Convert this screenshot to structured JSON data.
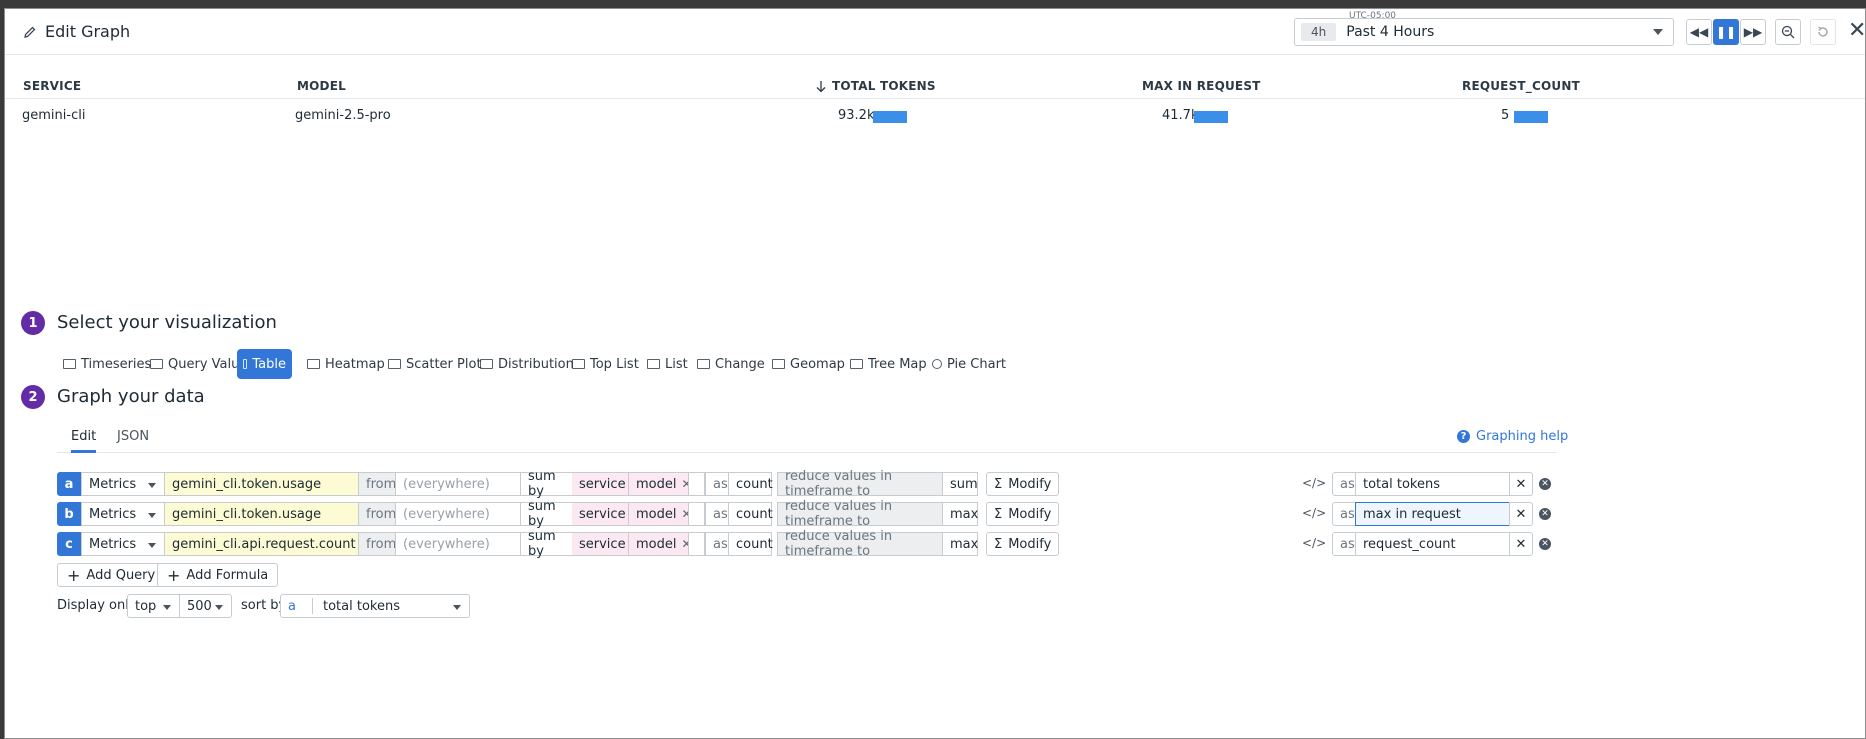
{
  "header": {
    "title": "Edit Graph",
    "timezone": "UTC-05:00",
    "time_chip": "4h",
    "time_range": "Past 4 Hours"
  },
  "table": {
    "columns": [
      "SERVICE",
      "MODEL",
      "TOTAL TOKENS",
      "MAX IN REQUEST",
      "REQUEST_COUNT"
    ],
    "rows": [
      {
        "service": "gemini-cli",
        "model": "gemini-2.5-pro",
        "total_tokens": "93.2k",
        "max_in_request": "41.7k",
        "request_count": "5"
      }
    ]
  },
  "step1": {
    "number": "1",
    "title": "Select your visualization"
  },
  "visualizations": [
    "Timeseries",
    "Query Value",
    "Table",
    "Heatmap",
    "Scatter Plot",
    "Distribution",
    "Top List",
    "List",
    "Change",
    "Geomap",
    "Tree Map",
    "Pie Chart"
  ],
  "selected_visualization": "Table",
  "step2": {
    "number": "2",
    "title": "Graph your data"
  },
  "tabs": [
    "Edit",
    "JSON"
  ],
  "graphing_help": "Graphing help",
  "query_labels": {
    "from": "from",
    "everywhere": "(everywhere)",
    "sum_by": "sum by",
    "as": "as",
    "reduce": "reduce values in timeframe to",
    "modify": "Modify",
    "code_icon": "</>"
  },
  "queries": [
    {
      "letter": "a",
      "source": "Metrics",
      "metric": "gemini_cli.token.usage",
      "tag1": "service",
      "tag2": "model",
      "as_type": "count",
      "reducer": "sum",
      "alias": "total tokens"
    },
    {
      "letter": "b",
      "source": "Metrics",
      "metric": "gemini_cli.token.usage",
      "tag1": "service",
      "tag2": "model",
      "as_type": "count",
      "reducer": "max",
      "alias": "max in request"
    },
    {
      "letter": "c",
      "source": "Metrics",
      "metric": "gemini_cli.api.request.count",
      "tag1": "service",
      "tag2": "model",
      "as_type": "count",
      "reducer": "max",
      "alias": "request_count"
    }
  ],
  "buttons": {
    "add_query": "Add Query",
    "add_formula": "Add Formula"
  },
  "display": {
    "label": "Display only",
    "order": "top",
    "limit": "500",
    "sort_label": "sort by",
    "sort_query": "a",
    "sort_value": "total tokens"
  },
  "colors": {
    "accent": "#3277d7",
    "step": "#632ca6",
    "bar": "#3b8fe8"
  }
}
